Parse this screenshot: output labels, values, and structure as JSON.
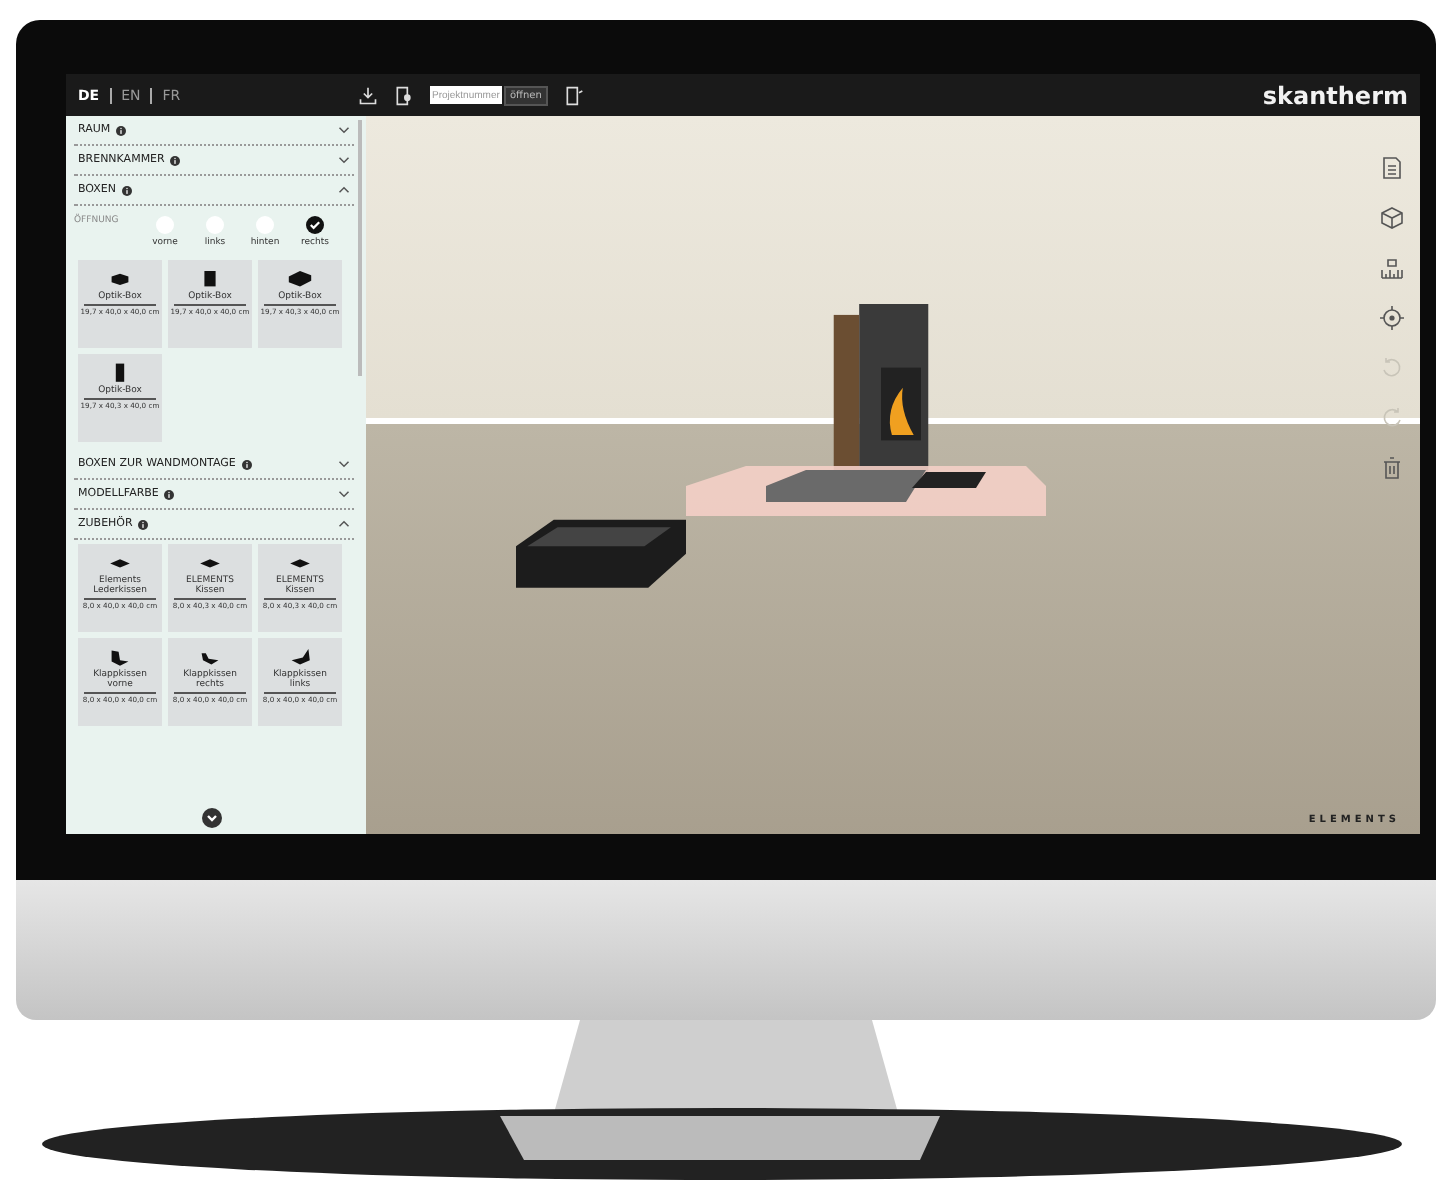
{
  "languages": [
    {
      "label": "DE",
      "selected": true
    },
    {
      "label": "EN",
      "selected": false
    },
    {
      "label": "FR",
      "selected": false
    }
  ],
  "toolbar": {
    "project_field": {
      "placeholder": "Projektnummer"
    },
    "open_button": "öffnen"
  },
  "brand": "skantherm",
  "sections": [
    {
      "title": "RAUM",
      "expanded": false
    },
    {
      "title": "BRENNKAMMER",
      "expanded": false
    },
    {
      "title": "BOXEN",
      "expanded": true,
      "opening": {
        "label": "ÖFFNUNG",
        "options": [
          {
            "label": "vorne",
            "checked": false
          },
          {
            "label": "links",
            "checked": false
          },
          {
            "label": "hinten",
            "checked": false
          },
          {
            "label": "rechts",
            "checked": true
          }
        ]
      },
      "products": [
        {
          "kind": "box-low",
          "name": "Optik-Box",
          "size": "19,7 x 40,0 x 40,0 cm"
        },
        {
          "kind": "box-tall",
          "name": "Optik-Box",
          "size": "19,7 x 40,0 x 40,0 cm"
        },
        {
          "kind": "box-wide",
          "name": "Optik-Box",
          "size": "19,7 x 40,3 x 40,0 cm"
        },
        {
          "kind": "box-upright",
          "name": "Optik-Box",
          "size": "19,7 x 40,3 x 40,0 cm"
        }
      ]
    },
    {
      "title": "BOXEN ZUR WANDMONTAGE",
      "expanded": false
    },
    {
      "title": "MODELLFARBE",
      "expanded": false
    },
    {
      "title": "ZUBEHÖR",
      "expanded": true,
      "products": [
        {
          "kind": "cushion",
          "name": "Elements Lederkissen",
          "size": "8,0 x 40,0 x 40,0 cm"
        },
        {
          "kind": "cushion",
          "name": "ELEMENTS Kissen",
          "size": "8,0 x 40,3 x 40,0 cm"
        },
        {
          "kind": "cushion",
          "name": "ELEMENTS Kissen",
          "size": "8,0 x 40,3 x 40,0 cm"
        },
        {
          "kind": "fold-front",
          "name": "Klappkissen vorne",
          "size": "8,0 x 40,0 x 40,0 cm"
        },
        {
          "kind": "fold-right",
          "name": "Klappkissen rechts",
          "size": "8,0 x 40,0 x 40,0 cm"
        },
        {
          "kind": "fold-left",
          "name": "Klappkissen links",
          "size": "8,0 x 40,0 x 40,0 cm"
        }
      ]
    }
  ],
  "tools": [
    {
      "kind": "document",
      "disabled": false
    },
    {
      "kind": "cube",
      "disabled": false
    },
    {
      "kind": "measure",
      "disabled": false
    },
    {
      "kind": "target",
      "disabled": false
    },
    {
      "kind": "undo",
      "disabled": true
    },
    {
      "kind": "redo",
      "disabled": true
    },
    {
      "kind": "trash",
      "disabled": false
    }
  ],
  "scene": {
    "collection": "ELEMENTS"
  }
}
